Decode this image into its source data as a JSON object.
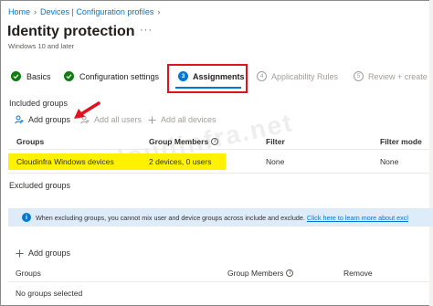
{
  "breadcrumb": {
    "home": "Home",
    "devices": "Devices | Configuration profiles"
  },
  "page": {
    "title": "Identity protection",
    "more": "···",
    "subtitle": "Windows 10 and later"
  },
  "steps": [
    {
      "label": "Basics",
      "state": "complete"
    },
    {
      "label": "Configuration settings",
      "state": "complete"
    },
    {
      "num": "3",
      "label": "Assignments",
      "state": "active"
    },
    {
      "num": "4",
      "label": "Applicability Rules",
      "state": "pending"
    },
    {
      "num": "5",
      "label": "Review + create",
      "state": "pending"
    }
  ],
  "included": {
    "heading": "Included groups",
    "commands": {
      "add_groups": "Add groups",
      "add_all_users": "Add all users",
      "add_all_devices": "Add all devices"
    },
    "columns": {
      "groups": "Groups",
      "members": "Group Members",
      "filter": "Filter",
      "filter_mode": "Filter mode"
    },
    "rows": [
      {
        "group": "Cloudinfra Windows devices",
        "members": "2 devices, 0 users",
        "filter": "None",
        "filter_mode": "None"
      }
    ]
  },
  "excluded": {
    "heading": "Excluded groups",
    "info_text": "When excluding groups, you cannot mix user and device groups across include and exclude.",
    "info_link": "Click here to learn more about excl",
    "commands": {
      "add_groups": "Add groups"
    },
    "columns": {
      "groups": "Groups",
      "members": "Group Members",
      "remove": "Remove"
    },
    "empty": "No groups selected"
  },
  "watermark": "cloudinfra.net",
  "colors": {
    "accent": "#0078d4",
    "success": "#107c10",
    "highlight": "#fff200",
    "annotation": "#e0121c",
    "info_bg": "#deecf9"
  }
}
